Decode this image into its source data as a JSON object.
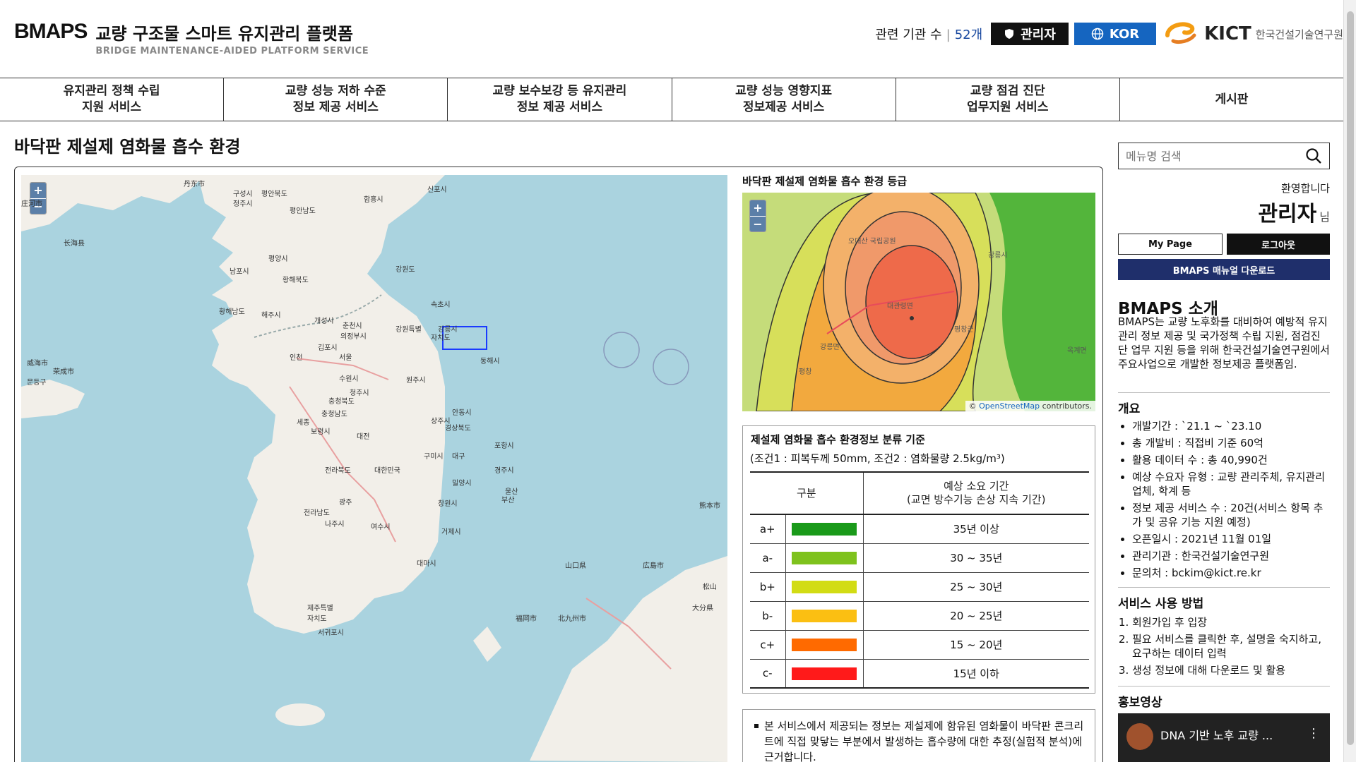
{
  "header": {
    "logo_mark": "BMAPS",
    "title": "교량 구조물 스마트 유지관리 플랫폼",
    "subtitle": "BRIDGE MAINTENANCE-AIDED PLATFORM SERVICE",
    "org_label": "관련 기관 수",
    "org_count": "52개",
    "admin_label": "관리자",
    "lang_label": "KOR",
    "kict_name": "KICT",
    "kict_korean": "한국건설기술연구원"
  },
  "nav": [
    "유지관리 정책 수립\n지원 서비스",
    "교량 성능 저하 수준\n정보 제공 서비스",
    "교량 보수보강 등 유지관리\n정보 제공 서비스",
    "교량 성능 영향지표\n정보제공 서비스",
    "교량 점검 진단\n업무지원 서비스",
    "게시판"
  ],
  "page_title": "바닥판 제설제 염화물 흡수 환경",
  "map": {
    "zoom_in": "+",
    "zoom_out": "−",
    "labels": [
      "丹东市",
      "구성시",
      "평안북도",
      "신포시",
      "함흥시",
      "庄河市",
      "정주시",
      "평안남도",
      "长海县",
      "평양시",
      "강원도",
      "남포시",
      "황해북도",
      "속초시",
      "황해남도",
      "해주시",
      "개성시",
      "강원특별",
      "의정부시",
      "춘천시",
      "자치도",
      "강릉시",
      "인천",
      "서울",
      "김포시",
      "동해시",
      "威海市",
      "荣成市",
      "문등구",
      "수원시",
      "원주시",
      "충청북도",
      "청주시",
      "안동시",
      "세종",
      "충청남도",
      "보령시",
      "대전",
      "상주시",
      "경상북도",
      "포항시",
      "구미시",
      "대구",
      "경주시",
      "전라북도",
      "대한민국",
      "울산",
      "광주",
      "창원시",
      "부산",
      "밀양시",
      "전라남도",
      "나주시",
      "여수시",
      "거제시",
      "대마시",
      "제주특별",
      "자치도",
      "서귀포시",
      "福岡市",
      "北九州市",
      "山口県",
      "広島市",
      "松山",
      "大分県",
      "熊本市"
    ],
    "small_labels": [
      "오대산 국립공원",
      "강릉시",
      "대관령면",
      "평창군",
      "강릉면",
      "옥계면",
      "평창"
    ]
  },
  "grade": {
    "title": "바닥판 제설제 염화물 흡수 환경 등급",
    "zoom_in": "+",
    "zoom_out": "−",
    "attribution_prefix": "©",
    "attribution_link": "OpenStreetMap",
    "attribution_suffix": "contributors."
  },
  "criteria": {
    "title": "제설제 염화물 흡수 환경정보 분류 기준",
    "subtitle": "(조건1 : 피복두께 50mm, 조건2 : 염화물량 2.5kg/m³)",
    "col_grade": "구분",
    "col_period": "예상 소요 기간\n(교면 방수기능 손상 지속 기간)",
    "rows": [
      {
        "grade": "a+",
        "color": "#1a9a1a",
        "period": "35년 이상"
      },
      {
        "grade": "a-",
        "color": "#7ec21d",
        "period": "30 ~ 35년"
      },
      {
        "grade": "b+",
        "color": "#d2dc14",
        "period": "25 ~ 30년"
      },
      {
        "grade": "b-",
        "color": "#fbbf12",
        "period": "20 ~ 25년"
      },
      {
        "grade": "c+",
        "color": "#ff6a00",
        "period": "15 ~ 20년"
      },
      {
        "grade": "c-",
        "color": "#ff1a1a",
        "period": "15년 이하"
      }
    ]
  },
  "note": "본 서비스에서 제공되는 정보는 제설제에 함유된 염화물이 바닥판 콘크리트에 직접 맞닿는 부분에서 발생하는 흡수량에 대한 추정(실험적 분석)에 근거합니다.",
  "sidebar": {
    "search_placeholder": "메뉴명 검색",
    "welcome": "환영합니다",
    "user_name": "관리자",
    "user_suffix": "님",
    "mypage": "My Page",
    "logout": "로그아웃",
    "manual": "BMAPS 매뉴얼 다운로드",
    "intro_title": "BMAPS 소개",
    "intro_text": "BMAPS는 교량 노후화를 대비하여 예방적 유지관리 정보 제공 및 국가정책 수립 지원, 점검진단 업무 지원 등을 위해 한국건설기술연구원에서 주요사업으로 개발한 정보제공 플랫폼임.",
    "overview_title": "개요",
    "overview": [
      "개발기간 : `21.1 ~ `23.10",
      "총 개발비 : 직접비 기준 60억",
      "활용 데이터 수 : 총 40,990건",
      "예상 수요자 유형 : 교량 관리주체, 유지관리 업체, 학계 등",
      "정보 제공 서비스 수 : 20건(서비스 항목 추가 및 공유 기능 지원 예정)",
      "오픈일시 : 2021년 11월 01일",
      "관리기관 : 한국건설기술연구원",
      "문의처 : bckim@kict.re.kr"
    ],
    "usage_title": "서비스 사용 방법",
    "usage": [
      "회원가입 후 입장",
      "필요 서비스를 클릭한 후, 설명을 숙지하고, 요구하는 데이터 입력",
      "생성 정보에 대해 다운로드 및 활용"
    ],
    "promo_title": "홍보영상",
    "video_title": "DNA 기반 노후 교량 ..."
  }
}
